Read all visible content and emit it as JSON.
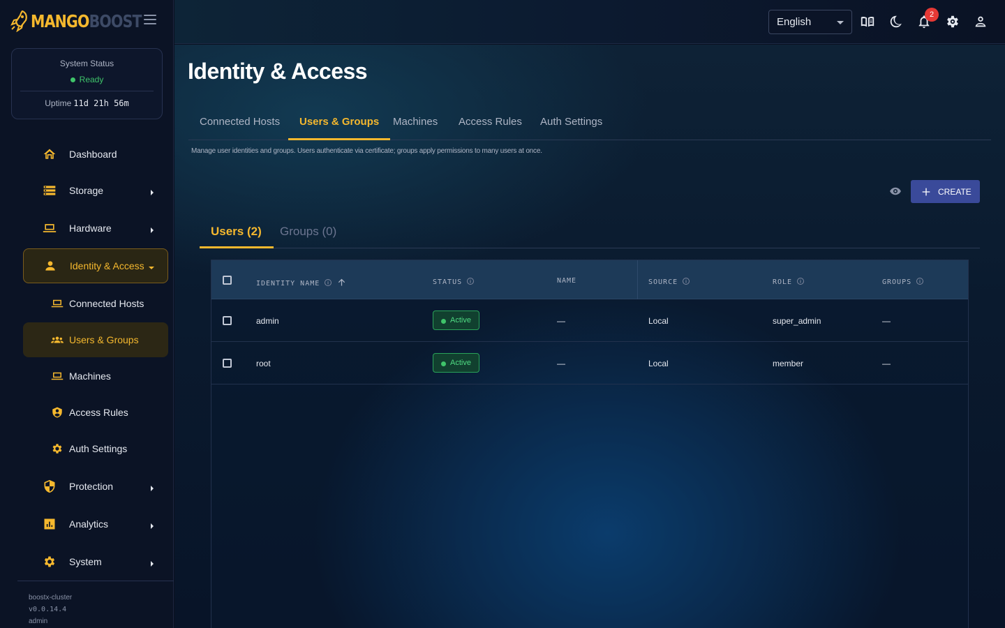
{
  "brand": {
    "part1": "MANGO",
    "part2": "BOOST"
  },
  "system_status": {
    "title": "System Status",
    "state": "Ready",
    "uptime_label": "Uptime",
    "uptime_value": "11d 21h 56m"
  },
  "nav": {
    "dashboard": "Dashboard",
    "storage": "Storage",
    "hardware": "Hardware",
    "identity": "Identity & Access",
    "connected_hosts": "Connected Hosts",
    "users_groups": "Users & Groups",
    "machines": "Machines",
    "access_rules": "Access Rules",
    "auth_settings": "Auth Settings",
    "protection": "Protection",
    "analytics": "Analytics",
    "system": "System"
  },
  "footer": {
    "cluster": "boostx-cluster",
    "version": "v0.0.14.4",
    "user": "admin"
  },
  "topbar": {
    "language": "English",
    "notification_count": "2"
  },
  "page": {
    "title": "Identity & Access",
    "tabs": [
      "Connected Hosts",
      "Users & Groups",
      "Machines",
      "Access Rules",
      "Auth Settings"
    ],
    "description": "Manage user identities and groups.  Users authenticate via certificate; groups apply permissions to many users at once."
  },
  "actions": {
    "create_label": "CREATE"
  },
  "subtabs": {
    "users": "Users (2)",
    "groups": "Groups (0)"
  },
  "table": {
    "headers": {
      "identity_name": "IDENTITY NAME",
      "status": "STATUS",
      "name": "NAME",
      "source": "SOURCE",
      "role": "ROLE",
      "groups": "GROUPS"
    },
    "rows": [
      {
        "identity_name": "admin",
        "status": "Active",
        "name": "—",
        "source": "Local",
        "role": "super_admin",
        "groups": "—"
      },
      {
        "identity_name": "root",
        "status": "Active",
        "name": "—",
        "source": "Local",
        "role": "member",
        "groups": "—"
      }
    ]
  },
  "colors": {
    "accent": "#f5b82e",
    "primary_button": "#3a4a9a",
    "status_active": "#3fc46a",
    "badge_alert": "#e53935"
  }
}
